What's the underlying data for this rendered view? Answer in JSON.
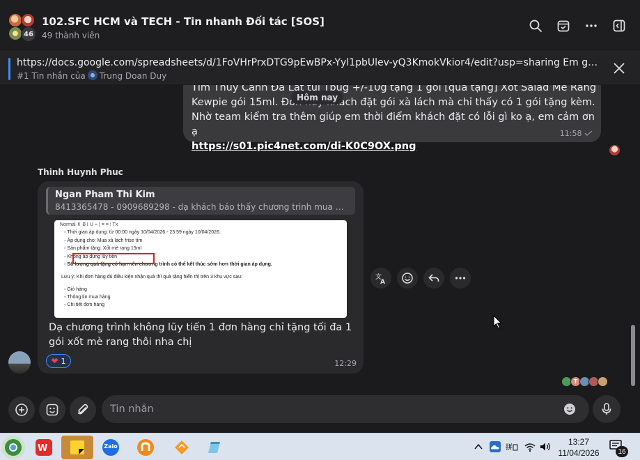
{
  "header": {
    "title": "102.SFC HCM và TECH - Tin nhanh Đối tác [SOS]",
    "members": "49 thành viên",
    "avatar_count": "46"
  },
  "pinned": {
    "text": "https://docs.google.com/spreadsheets/d/1FoVHrPrxDTG9pEwBPx-Yyl1pbUlev-yQ3KmokVkior4/edit?usp=sharing Em gửi link ...",
    "sub_prefix": "#1 Tin nhắn của",
    "sub_author": "Trung Doan Duy"
  },
  "messages": {
    "day_chip": "Hôm nay",
    "me": {
      "text": "Tìm Thủy Cảnh Đà Lạt túi Tbug +/-10g tặng 1 gói [quà tặng] Xốt Salad Mè Rang Kewpie gói 15ml. Đơn này khách đặt gói xà lách mà chỉ thấy có 1 gói tặng kèm. Nhờ team kiểm tra thêm giúp em thời điểm khách đặt có lỗi gì ko ạ, em cảm ơn ạ",
      "link": "https://s01.pic4net.com/di-K0C9OX.png",
      "time": "11:58"
    },
    "other": {
      "sender": "Thinh Huynh Phuc",
      "quote_name": "Ngan Pham Thi Kim",
      "quote_text": "8413365478 - 0909689298 - dạ khách báo thấy chương trình mua 1 xà lách tặng...",
      "image": {
        "toolbar": "Normal    ⇕     B   I   U   ⌁   |   ≡   ≡   ⁞   Tx",
        "lines": [
          "◦  Thời gian áp dụng: từ 00:00 ngày 10/04/2026 - 23:59 ngày 10/04/2026.",
          "◦  Áp dụng cho: Mua xà lách frise tím",
          "◦  Sản phẩm tặng:  Xốt mè rang 15ml",
          "◦  Không áp dụng lũy tiến",
          "◦  Số lượng quà tặng có hạn nên chương trình có thể kết thúc sớm hơn thời gian áp dụng.",
          "Lưu ý: Khi đơn hàng đủ điều kiện nhận quà thì quà tặng hiển thị trên 3 khu vực sau:",
          "◦  Giỏ hàng",
          "◦  Thông tin mua hàng",
          "◦  Chi tiết đơn hàng"
        ]
      },
      "text": "Dạ chương trình không lũy tiến 1 đơn hàng chỉ tặng tối đa 1 gói xốt mè rang thôi nha chị",
      "reaction_count": "1",
      "time": "12:29"
    },
    "seen_initial": "T"
  },
  "composer": {
    "placeholder": "Tin nhắn"
  },
  "taskbar": {
    "time": "13:27",
    "date": "11/04/2026",
    "notifications": "16",
    "zalo_label": "Zalo"
  }
}
